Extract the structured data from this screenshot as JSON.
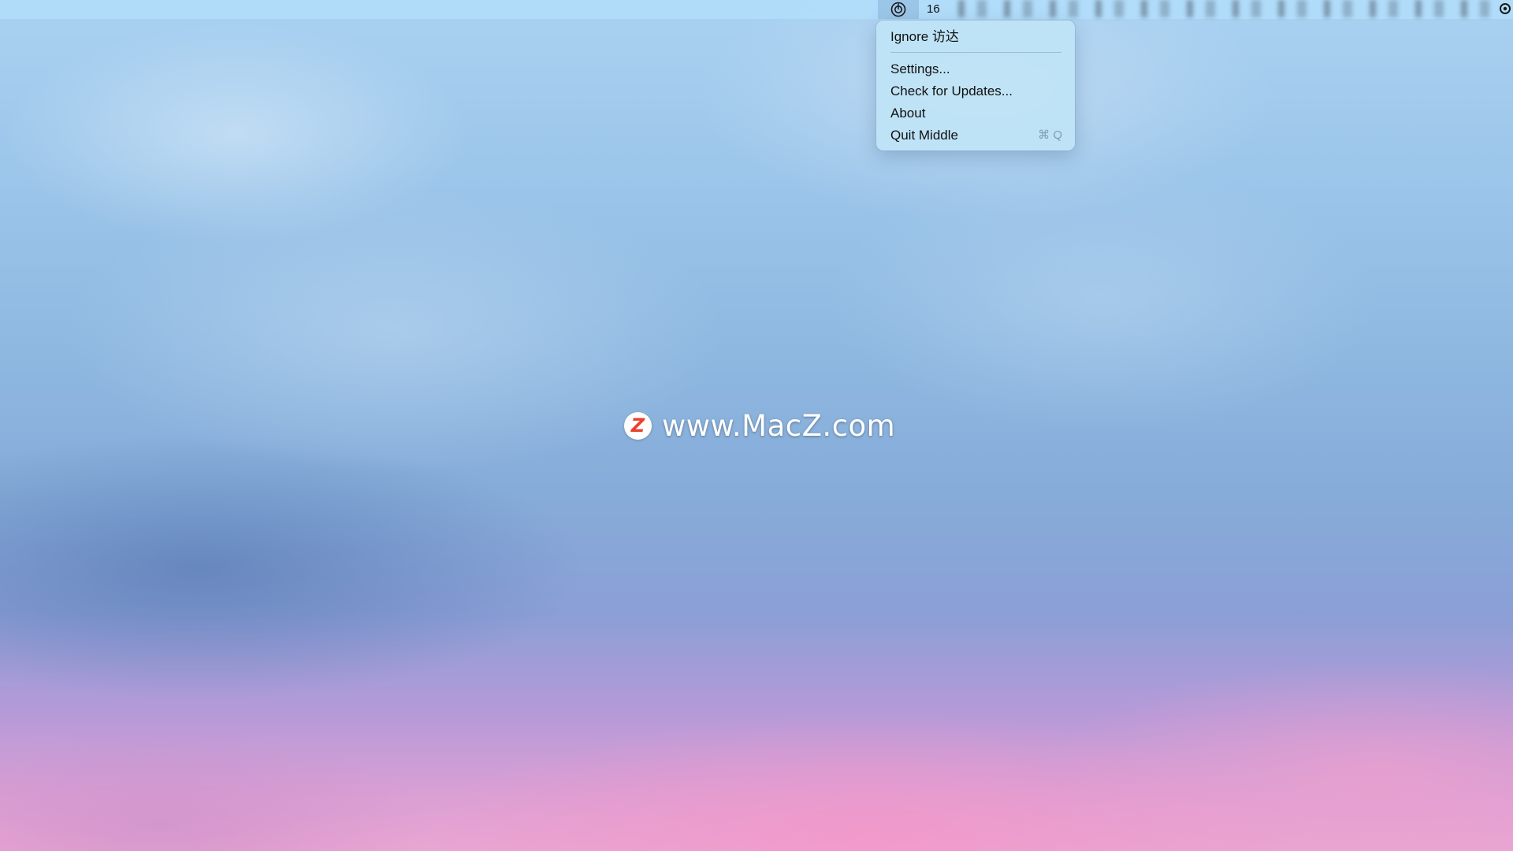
{
  "menubar": {
    "app_icon": "middle-app-icon",
    "count": "16",
    "right_icon": "gear-icon"
  },
  "dropdown": {
    "items": [
      {
        "label": "Ignore 访达"
      },
      {
        "label": "Settings..."
      },
      {
        "label": "Check for Updates..."
      },
      {
        "label": "About"
      },
      {
        "label": "Quit Middle",
        "shortcut": "⌘ Q"
      }
    ]
  },
  "watermark": {
    "logo_letter": "Z",
    "text": "www.MacZ.com"
  },
  "colors": {
    "menubar": "#b2defc",
    "dropdown": "#c0e4f6",
    "watermark_logo": "#e8412c"
  }
}
